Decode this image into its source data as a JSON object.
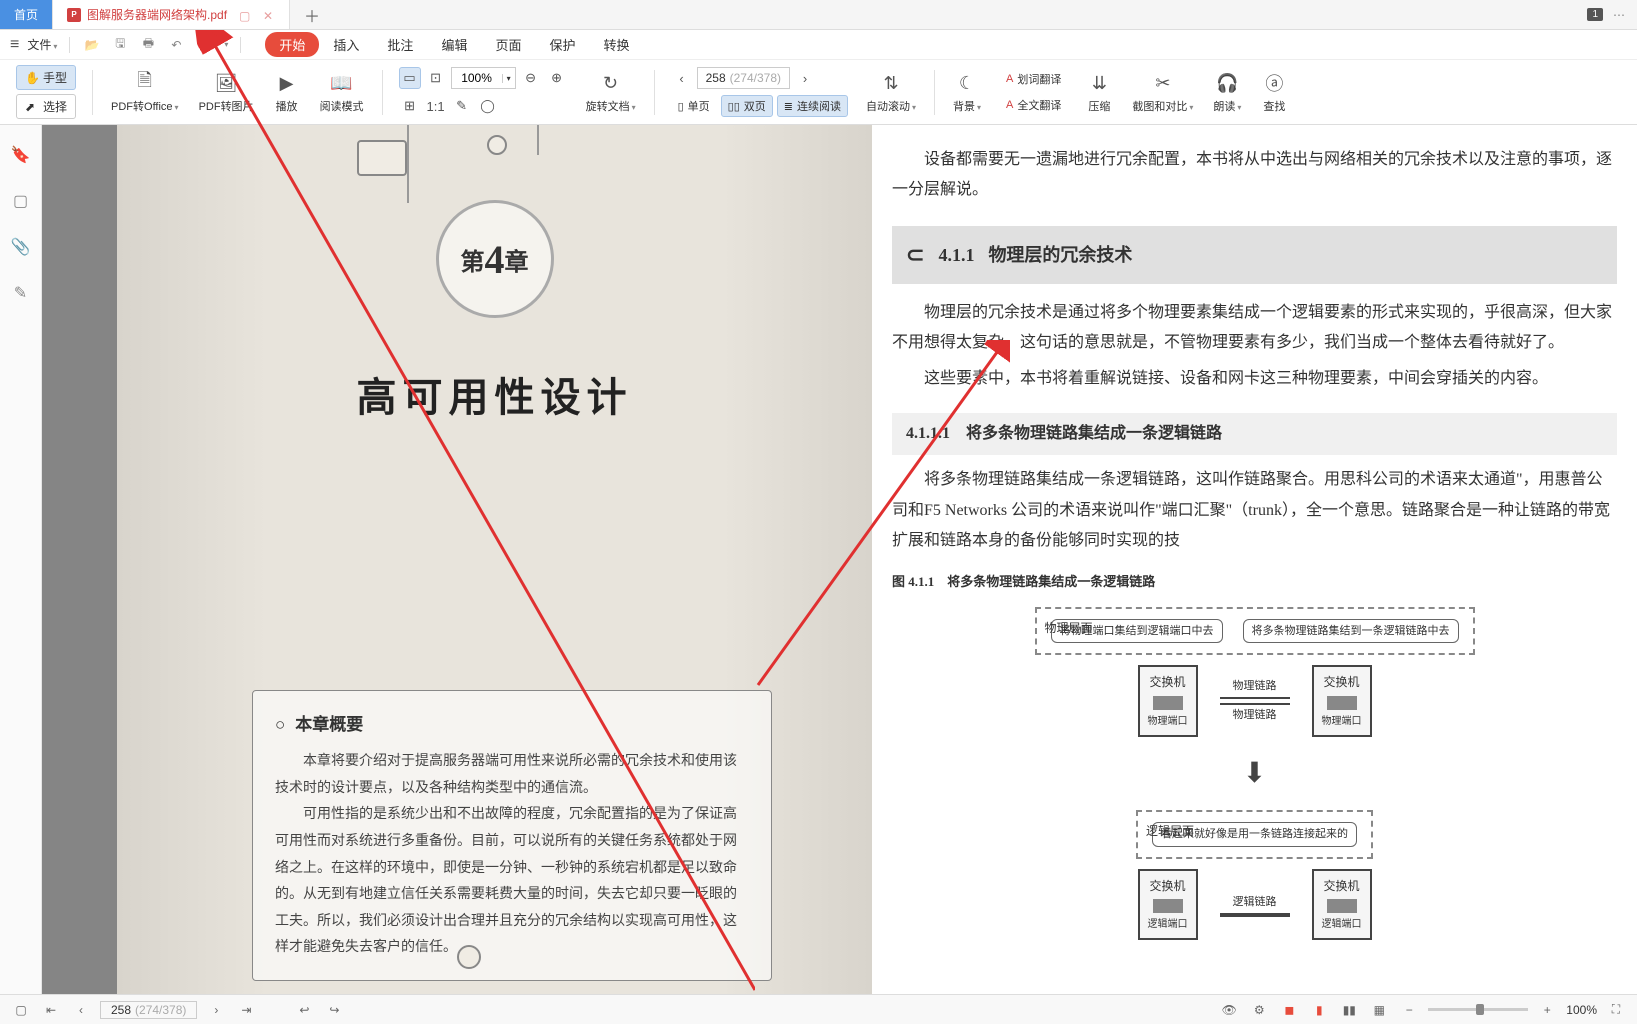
{
  "tabs": {
    "home": "首页",
    "active_name": "图解服务器端网络架构.pdf",
    "count": "1"
  },
  "quickbar": {
    "file_label": "文件"
  },
  "menu": {
    "start": "开始",
    "insert": "插入",
    "annotate": "批注",
    "edit": "编辑",
    "page": "页面",
    "protect": "保护",
    "convert": "转换"
  },
  "ribbon": {
    "hand_tool": "手型",
    "select_tool": "选择",
    "pdf_to_office": "PDF转Office",
    "pdf_to_image": "PDF转图片",
    "play": "播放",
    "reading_mode": "阅读模式",
    "zoom_value": "100%",
    "rotate_doc": "旋转文档",
    "page_current": "258",
    "page_range": "(274/378)",
    "single_page": "单页",
    "double_page": "双页",
    "continuous_read": "连续阅读",
    "auto_scroll": "自动滚动",
    "background": "背景",
    "word_translate": "划词翻译",
    "full_translate": "全文翻译",
    "compress": "压缩",
    "screenshot_compare": "截图和对比",
    "read_aloud": "朗读",
    "find": "查找"
  },
  "left_page": {
    "chapter_prefix": "第",
    "chapter_num": "4",
    "chapter_suffix": "章",
    "chapter_title": "高可用性设计",
    "section_heading": "本章概要",
    "para1": "本章将要介绍对于提高服务器端可用性来说所必需的冗余技术和使用该技术时的设计要点，以及各种结构类型中的通信流。",
    "para2": "可用性指的是系统少出和不出故障的程度，冗余配置指的是为了保证高可用性而对系统进行多重备份。目前，可以说所有的关键任务系统都处于网络之上。在这样的环境中，即使是一分钟、一秒钟的系统宕机都是足以致命的。从无到有地建立信任关系需要耗费大量的时间，失去它却只要一眨眼的工夫。所以，我们必须设计出合理并且充分的冗余结构以实现高可用性，这样才能避免失去客户的信任。"
  },
  "right_page": {
    "intro": "设备都需要无一遗漏地进行冗余配置，本书将从中选出与网络相关的冗余技术以及注意的事项，逐一分层解说。",
    "h411_num": "4.1.1",
    "h411_title": "物理层的冗余技术",
    "p411_1": "物理层的冗余技术是通过将多个物理要素集结成一个逻辑要素的形式来实现的，乎很高深，但大家不用想得太复杂。这句话的意思就是，不管物理要素有多少，我们当成一个整体去看待就好了。",
    "p411_2": "这些要素中，本书将着重解说链接、设备和网卡这三种物理要素，中间会穿插关的内容。",
    "h4111_num": "4.1.1.1",
    "h4111_title": "将多条物理链路集结成一条逻辑链路",
    "p4111_1": "将多条物理链路集结成一条逻辑链路，这叫作链路聚合。用思科公司的术语来太通道\"，用惠普公司和F5 Networks 公司的术语来说叫作\"端口汇聚\"（trunk），全一个意思。链路聚合是一种让链路的带宽扩展和链路本身的备份能够同时实现的技",
    "fig_label": "图 4.1.1　将多条物理链路集结成一条逻辑链路",
    "diagram": {
      "phys_layer": "物理层面",
      "logic_layer": "逻辑层面",
      "bubble1": "将物理端口集结到逻辑端口中去",
      "bubble2": "将多条物理链路集结到一条逻辑链路中去",
      "bubble3": "看起来就好像是用一条链路连接起来的",
      "switch": "交换机",
      "phys_link": "物理链路",
      "phys_port": "物理端口",
      "logic_link": "逻辑链路",
      "logic_port": "逻辑端口"
    }
  },
  "statusbar": {
    "page_current": "258",
    "page_range": "(274/378)",
    "zoom_value": "100%"
  }
}
